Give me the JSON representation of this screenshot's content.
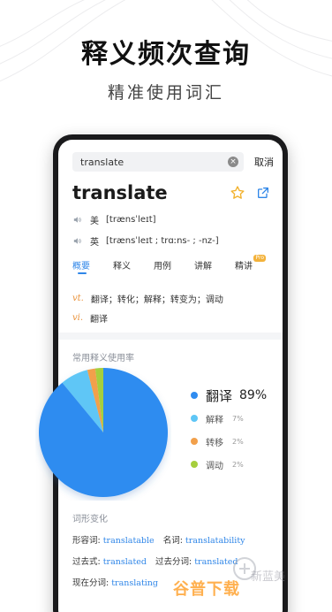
{
  "promo": {
    "title": "释义频次查询",
    "subtitle": "精准使用词汇"
  },
  "search": {
    "query": "translate",
    "clear_icon": "clear-icon",
    "cancel_label": "取消"
  },
  "word": {
    "headword": "translate",
    "icons": [
      "star-outline-icon",
      "share-icon"
    ],
    "pronunciations": [
      {
        "region": "美",
        "ipa": "[trænsˈleɪt]"
      },
      {
        "region": "英",
        "ipa": "[trænsˈleɪt ; trɑːns- ; -nz-]"
      }
    ]
  },
  "tabs": [
    {
      "label": "概要",
      "active": true
    },
    {
      "label": "释义",
      "active": false
    },
    {
      "label": "用例",
      "active": false
    },
    {
      "label": "讲解",
      "active": false
    },
    {
      "label": "精讲",
      "active": false,
      "badge": "Pro"
    }
  ],
  "definitions": [
    {
      "pos": "vt.",
      "text": "翻译；转化；解释；转变为；调动"
    },
    {
      "pos": "vi.",
      "text": "翻译"
    }
  ],
  "usage": {
    "label": "常用释义使用率"
  },
  "chart_data": {
    "type": "pie",
    "labels": [
      "翻译",
      "解释",
      "转移",
      "调动"
    ],
    "values": [
      89,
      7,
      2,
      2
    ],
    "value_labels": [
      "89%",
      "7%",
      "2%",
      "2%"
    ],
    "colors": [
      "#2f8cf0",
      "#5ec6f6",
      "#f2a04b",
      "#a6cf3d"
    ],
    "legend_position": "right"
  },
  "morphology": {
    "label": "词形变化",
    "rows": [
      [
        {
          "label": "形容词:",
          "value": "translatable"
        },
        {
          "label": "名词:",
          "value": "translatability"
        }
      ],
      [
        {
          "label": "过去式:",
          "value": "translated"
        },
        {
          "label": "过去分词:",
          "value": "translated"
        }
      ],
      [
        {
          "label": "现在分词:",
          "value": "translating"
        }
      ]
    ]
  },
  "watermark": {
    "text": "谷普下载",
    "faded_text": "新蓝美"
  }
}
